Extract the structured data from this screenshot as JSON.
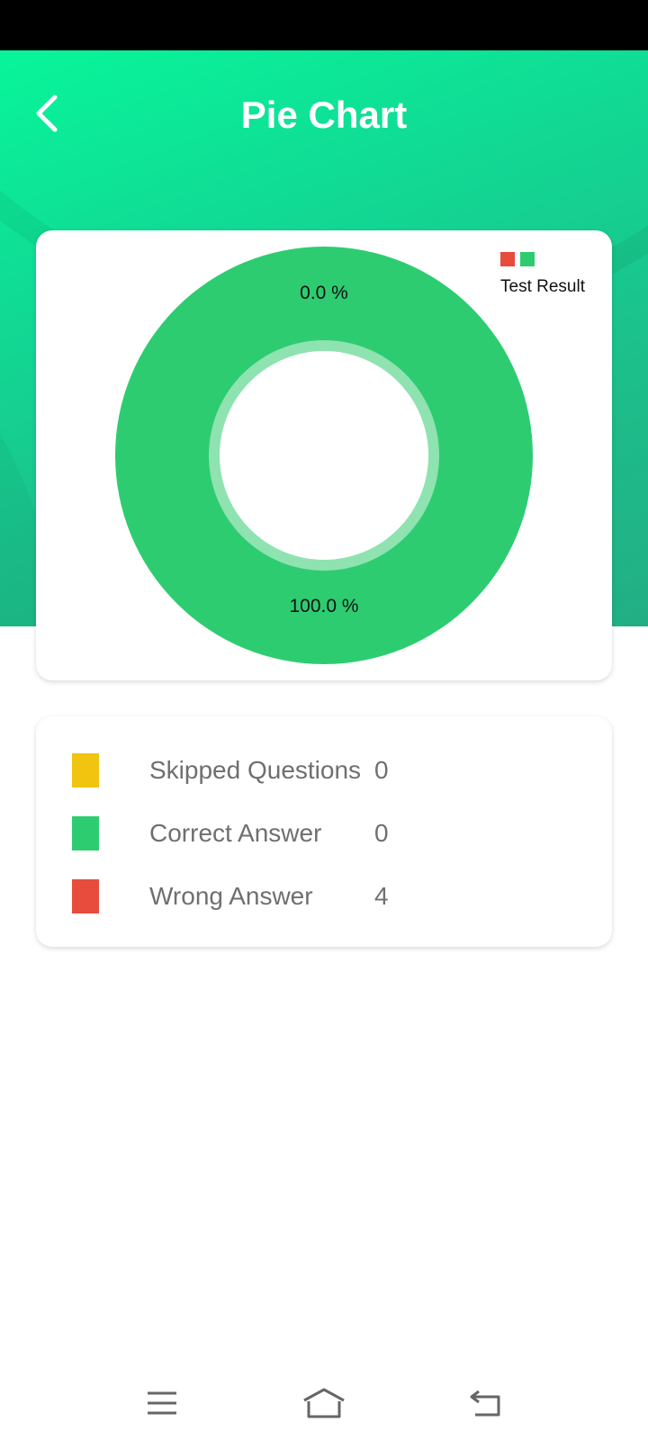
{
  "header": {
    "title": "Pie Chart"
  },
  "chart_data": {
    "type": "pie",
    "style": "donut",
    "legend": {
      "label": "Test Result",
      "placement": "top-right",
      "colors": [
        "#e74c3c",
        "#2ecc71"
      ]
    },
    "slices": [
      {
        "value": 0.0,
        "label": "0.0 %",
        "color": "#e74c3c"
      },
      {
        "value": 100.0,
        "label": "100.0 %",
        "color": "#2ecc71"
      }
    ],
    "hole_ring_color": "#8ee3b0"
  },
  "stats": [
    {
      "label": "Skipped Questions",
      "value": "0",
      "color": "#f1c40f"
    },
    {
      "label": "Correct Answer",
      "value": "0",
      "color": "#2ecc71"
    },
    {
      "label": "Wrong Answer",
      "value": "4",
      "color": "#e74c3c"
    }
  ],
  "icons": {
    "back": "chevron-left-icon",
    "menu": "menu-icon",
    "home": "home-icon",
    "return": "return-icon"
  }
}
